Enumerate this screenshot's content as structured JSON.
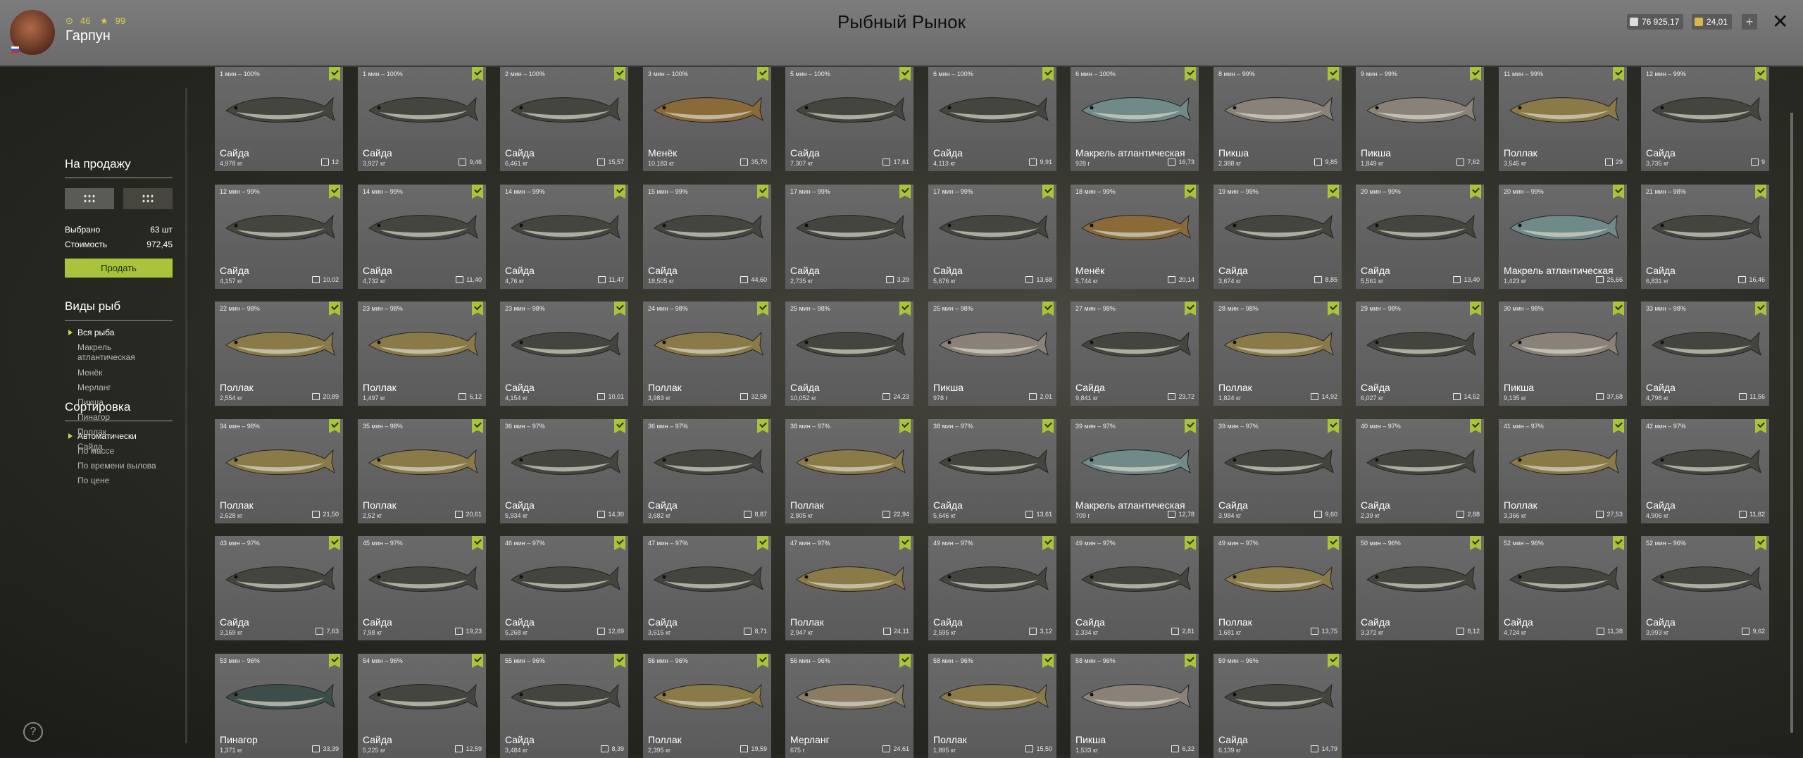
{
  "header": {
    "title": "Рыбный Рынок",
    "player": {
      "name": "Гарпун",
      "stat1": "46",
      "stat2": "99"
    },
    "silver": "76 925,17",
    "gold": "24,01",
    "plus_label": "+",
    "close_label": "✕"
  },
  "sidebar": {
    "sale_title": "На продажу",
    "selected_label": "Выбрано",
    "selected_value": "63 шт",
    "cost_label": "Стоимость",
    "cost_value": "972,45",
    "sell_button": "Продать",
    "species_title": "Виды рыб",
    "species": [
      "Вся рыба",
      "Макрель атлантическая",
      "Менёк",
      "Мерланг",
      "Пикша",
      "Пинагор",
      "Поллак",
      "Сайда"
    ],
    "sort_title": "Сортировка",
    "sort_options": [
      "Автоматически",
      "По массе",
      "По времени вылова",
      "По цене"
    ],
    "help_label": "?"
  },
  "fish_colors": {
    "Сайда": "#45453f",
    "Менёк": "#8a6a38",
    "Макрель атлантическая": "#6f8a88",
    "Пикша": "#8a8278",
    "Поллак": "#8a7a48",
    "Пинагор": "#3d4e4a",
    "Мерланг": "#8a7c62"
  },
  "fish": [
    {
      "time": "1 мин – 100%",
      "name": "Сайда",
      "weight": "4,978 кг",
      "price": "12"
    },
    {
      "time": "1 мин – 100%",
      "name": "Сайда",
      "weight": "3,927 кг",
      "price": "9,46"
    },
    {
      "time": "2 мин – 100%",
      "name": "Сайда",
      "weight": "6,461 кг",
      "price": "15,57"
    },
    {
      "time": "3 мин – 100%",
      "name": "Менёк",
      "weight": "10,183 кг",
      "price": "35,70"
    },
    {
      "time": "5 мин – 100%",
      "name": "Сайда",
      "weight": "7,307 кг",
      "price": "17,61"
    },
    {
      "time": "6 мин – 100%",
      "name": "Сайда",
      "weight": "4,113 кг",
      "price": "9,91"
    },
    {
      "time": "6 мин – 100%",
      "name": "Макрель атлантическая",
      "weight": "928 г",
      "price": "16,73"
    },
    {
      "time": "8 мин – 99%",
      "name": "Пикша",
      "weight": "2,388 кг",
      "price": "9,85"
    },
    {
      "time": "9 мин – 99%",
      "name": "Пикша",
      "weight": "1,849 кг",
      "price": "7,62"
    },
    {
      "time": "11 мин – 99%",
      "name": "Поллак",
      "weight": "3,545 кг",
      "price": "29"
    },
    {
      "time": "12 мин – 99%",
      "name": "Сайда",
      "weight": "3,735 кг",
      "price": "9"
    },
    {
      "time": "12 мин – 99%",
      "name": "Сайда",
      "weight": "4,157 кг",
      "price": "10,02"
    },
    {
      "time": "14 мин – 99%",
      "name": "Сайда",
      "weight": "4,732 кг",
      "price": "11,40"
    },
    {
      "time": "14 мин – 99%",
      "name": "Сайда",
      "weight": "4,76 кг",
      "price": "11,47"
    },
    {
      "time": "15 мин – 99%",
      "name": "Сайда",
      "weight": "18,505 кг",
      "price": "44,60"
    },
    {
      "time": "17 мин – 99%",
      "name": "Сайда",
      "weight": "2,735 кг",
      "price": "3,29"
    },
    {
      "time": "17 мин – 99%",
      "name": "Сайда",
      "weight": "5,676 кг",
      "price": "13,68"
    },
    {
      "time": "18 мин – 99%",
      "name": "Менёк",
      "weight": "5,744 кг",
      "price": "20,14"
    },
    {
      "time": "19 мин – 99%",
      "name": "Сайда",
      "weight": "3,674 кг",
      "price": "8,85"
    },
    {
      "time": "20 мин – 99%",
      "name": "Сайда",
      "weight": "5,561 кг",
      "price": "13,40"
    },
    {
      "time": "20 мин – 99%",
      "name": "Макрель атлантическая",
      "weight": "1,423 кг",
      "price": "25,66"
    },
    {
      "time": "21 мин – 98%",
      "name": "Сайда",
      "weight": "6,831 кг",
      "price": "16,46"
    },
    {
      "time": "22 мин – 98%",
      "name": "Поллак",
      "weight": "2,554 кг",
      "price": "20,89"
    },
    {
      "time": "23 мин – 98%",
      "name": "Поллак",
      "weight": "1,497 кг",
      "price": "6,12"
    },
    {
      "time": "23 мин – 98%",
      "name": "Сайда",
      "weight": "4,154 кг",
      "price": "10,01"
    },
    {
      "time": "24 мин – 98%",
      "name": "Поллак",
      "weight": "3,983 кг",
      "price": "32,58"
    },
    {
      "time": "25 мин – 98%",
      "name": "Сайда",
      "weight": "10,052 кг",
      "price": "24,23"
    },
    {
      "time": "25 мин – 98%",
      "name": "Пикша",
      "weight": "978 г",
      "price": "2,01"
    },
    {
      "time": "27 мин – 98%",
      "name": "Сайда",
      "weight": "9,841 кг",
      "price": "23,72"
    },
    {
      "time": "28 мин – 98%",
      "name": "Поллак",
      "weight": "1,824 кг",
      "price": "14,92"
    },
    {
      "time": "29 мин – 98%",
      "name": "Сайда",
      "weight": "6,027 кг",
      "price": "14,52"
    },
    {
      "time": "30 мин – 98%",
      "name": "Пикша",
      "weight": "9,135 кг",
      "price": "37,68"
    },
    {
      "time": "33 мин – 98%",
      "name": "Сайда",
      "weight": "4,798 кг",
      "price": "11,56"
    },
    {
      "time": "34 мин – 98%",
      "name": "Поллак",
      "weight": "2,628 кг",
      "price": "21,50"
    },
    {
      "time": "35 мин – 98%",
      "name": "Поллак",
      "weight": "2,52 кг",
      "price": "20,61"
    },
    {
      "time": "36 мин – 97%",
      "name": "Сайда",
      "weight": "5,934 кг",
      "price": "14,30"
    },
    {
      "time": "36 мин – 97%",
      "name": "Сайда",
      "weight": "3,682 кг",
      "price": "8,87"
    },
    {
      "time": "38 мин – 97%",
      "name": "Поллак",
      "weight": "2,805 кг",
      "price": "22,94"
    },
    {
      "time": "38 мин – 97%",
      "name": "Сайда",
      "weight": "5,646 кг",
      "price": "13,61"
    },
    {
      "time": "39 мин – 97%",
      "name": "Макрель атлантическая",
      "weight": "709 г",
      "price": "12,78"
    },
    {
      "time": "39 мин – 97%",
      "name": "Сайда",
      "weight": "3,984 кг",
      "price": "9,60"
    },
    {
      "time": "40 мин – 97%",
      "name": "Сайда",
      "weight": "2,39 кг",
      "price": "2,88"
    },
    {
      "time": "41 мин – 97%",
      "name": "Поллак",
      "weight": "3,366 кг",
      "price": "27,53"
    },
    {
      "time": "42 мин – 97%",
      "name": "Сайда",
      "weight": "4,906 кг",
      "price": "11,82"
    },
    {
      "time": "43 мин – 97%",
      "name": "Сайда",
      "weight": "3,169 кг",
      "price": "7,63"
    },
    {
      "time": "45 мин – 97%",
      "name": "Сайда",
      "weight": "7,98 кг",
      "price": "19,23"
    },
    {
      "time": "46 мин – 97%",
      "name": "Сайда",
      "weight": "5,268 кг",
      "price": "12,69"
    },
    {
      "time": "47 мин – 97%",
      "name": "Сайда",
      "weight": "3,615 кг",
      "price": "8,71"
    },
    {
      "time": "47 мин – 97%",
      "name": "Поллак",
      "weight": "2,947 кг",
      "price": "24,11"
    },
    {
      "time": "49 мин – 97%",
      "name": "Сайда",
      "weight": "2,595 кг",
      "price": "3,12"
    },
    {
      "time": "49 мин – 97%",
      "name": "Сайда",
      "weight": "2,334 кг",
      "price": "2,81"
    },
    {
      "time": "49 мин – 97%",
      "name": "Поллак",
      "weight": "1,681 кг",
      "price": "13,75"
    },
    {
      "time": "50 мин – 96%",
      "name": "Сайда",
      "weight": "3,372 кг",
      "price": "8,12"
    },
    {
      "time": "52 мин – 96%",
      "name": "Сайда",
      "weight": "4,724 кг",
      "price": "11,38"
    },
    {
      "time": "52 мин – 96%",
      "name": "Сайда",
      "weight": "3,993 кг",
      "price": "9,62"
    },
    {
      "time": "53 мин – 96%",
      "name": "Пинагор",
      "weight": "1,371 кг",
      "price": "33,39"
    },
    {
      "time": "54 мин – 96%",
      "name": "Сайда",
      "weight": "5,225 кг",
      "price": "12,59"
    },
    {
      "time": "55 мин – 96%",
      "name": "Сайда",
      "weight": "3,484 кг",
      "price": "8,39"
    },
    {
      "time": "56 мин – 96%",
      "name": "Поллак",
      "weight": "2,395 кг",
      "price": "19,59"
    },
    {
      "time": "56 мин – 96%",
      "name": "Мерланг",
      "weight": "675 г",
      "price": "24,61"
    },
    {
      "time": "58 мин – 96%",
      "name": "Поллак",
      "weight": "1,895 кг",
      "price": "15,50"
    },
    {
      "time": "58 мин – 96%",
      "name": "Пикша",
      "weight": "1,533 кг",
      "price": "6,32"
    },
    {
      "time": "59 мин – 96%",
      "name": "Сайда",
      "weight": "6,139 кг",
      "price": "14,79"
    }
  ]
}
